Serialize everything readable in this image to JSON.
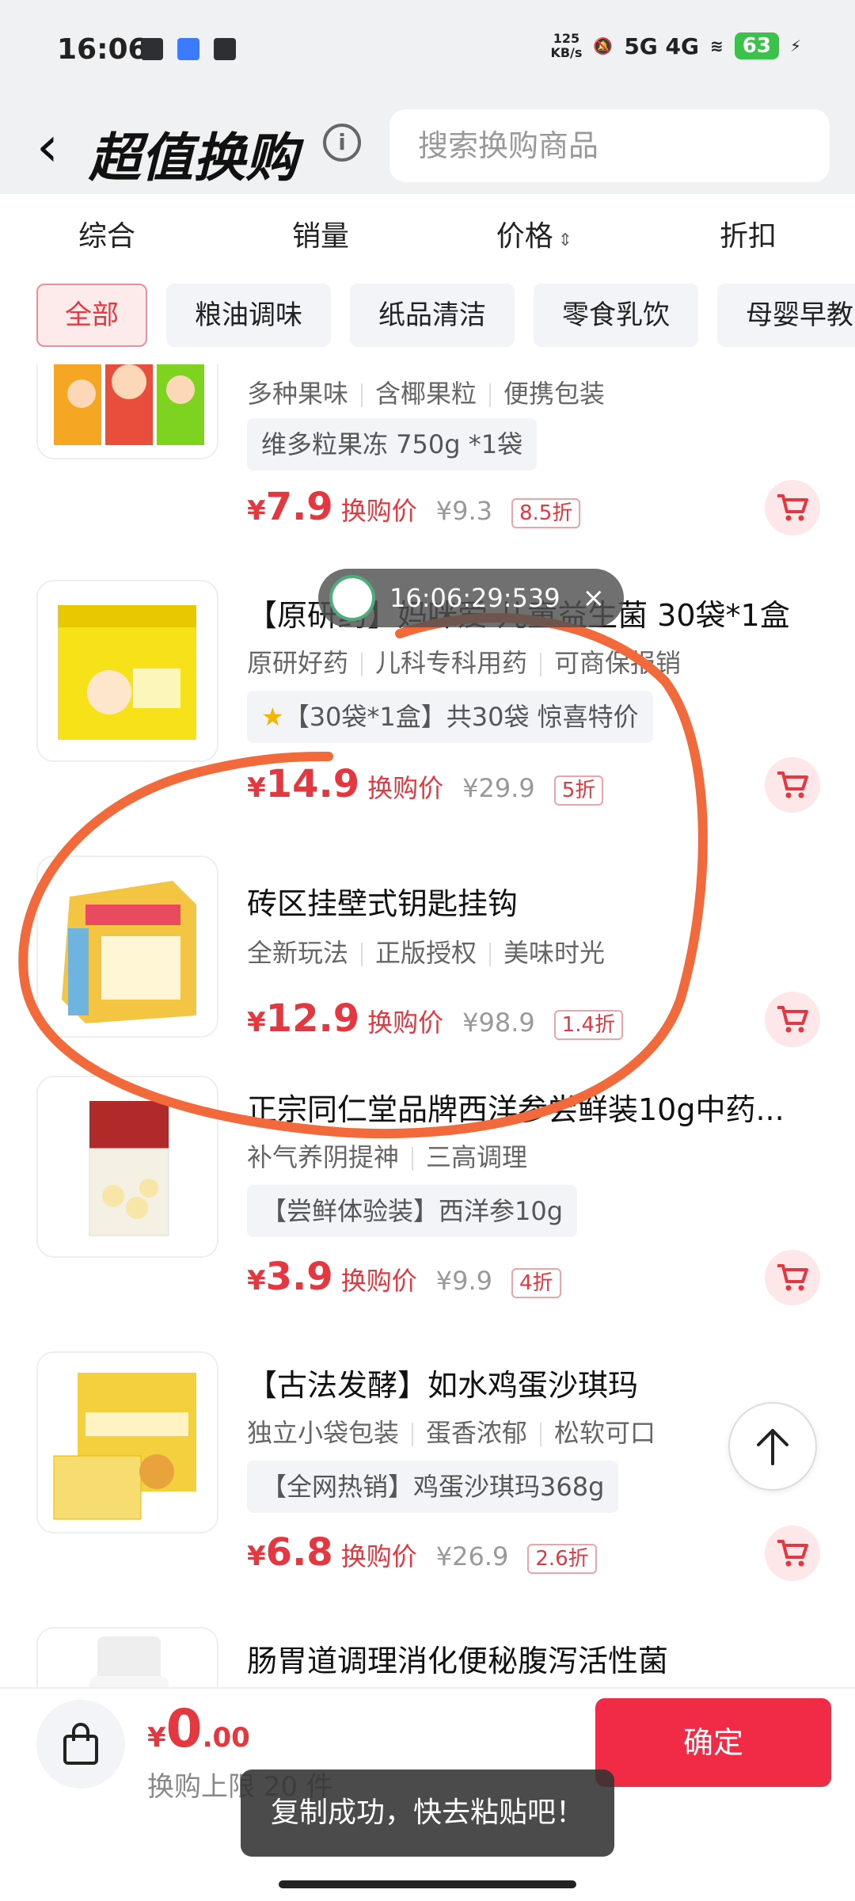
{
  "status_bar": {
    "time": "16:06",
    "speed": "125",
    "speed_unit": "KB/s",
    "network": "5G 4G",
    "battery": "63"
  },
  "header": {
    "back_icon": "chevron-left-icon",
    "title": "超值换购",
    "info_icon": "info-icon",
    "search_placeholder": "搜索换购商品"
  },
  "sort_tabs": [
    {
      "label": "综合"
    },
    {
      "label": "销量"
    },
    {
      "label": "价格"
    },
    {
      "label": "折扣"
    }
  ],
  "sort_sort_icon": "⌃⌄",
  "category_chips": [
    {
      "label": "全部",
      "active": true
    },
    {
      "label": "粮油调味"
    },
    {
      "label": "纸品清洁"
    },
    {
      "label": "零食乳饮"
    },
    {
      "label": "母婴早教"
    }
  ],
  "products": [
    {
      "name": "",
      "tags": [
        "多种果味",
        "含椰果粒",
        "便携包装"
      ],
      "spec": "维多粒果冻 750g *1袋",
      "price": "7.9",
      "price_label": "换购价",
      "orig_price": "¥9.3",
      "discount": "8.5折"
    },
    {
      "name": "【原研药】妈咪爱 儿童益生菌 30袋*1盒",
      "tags": [
        "原研好药",
        "儿科专科用药",
        "可商保报销"
      ],
      "spec": "【30袋*1盒】共30袋 惊喜特价",
      "price": "14.9",
      "price_label": "换购价",
      "orig_price": "¥29.9",
      "discount": "5折"
    },
    {
      "name": "砖区挂壁式钥匙挂钩",
      "tags": [
        "全新玩法",
        "正版授权",
        "美味时光"
      ],
      "spec": "",
      "price": "12.9",
      "price_label": "换购价",
      "orig_price": "¥98.9",
      "discount": "1.4折"
    },
    {
      "name": "正宗同仁堂品牌西洋参尝鲜装10g中药...",
      "tags": [
        "补气养阴提神",
        "三高调理"
      ],
      "spec": "【尝鲜体验装】西洋参10g",
      "price": "3.9",
      "price_label": "换购价",
      "orig_price": "¥9.9",
      "discount": "4折"
    },
    {
      "name": "【古法发酵】如水鸡蛋沙琪玛",
      "tags": [
        "独立小袋包装",
        "蛋香浓郁",
        "松软可口"
      ],
      "spec": "【全网热销】鸡蛋沙琪玛368g",
      "price": "6.8",
      "price_label": "换购价",
      "orig_price": "¥26.9",
      "discount": "2.6折"
    },
    {
      "name": "肠胃道调理消化便秘腹泻活性菌",
      "tags": [],
      "spec": "",
      "price": "",
      "price_label": "",
      "orig_price": "",
      "discount": ""
    }
  ],
  "timer_overlay": {
    "text": "16:06:29:539",
    "close": "×"
  },
  "bottom_bar": {
    "currency": "¥",
    "total_int": "0",
    "total_dec": ".00",
    "limit_text": "换购上限 20 件",
    "confirm_label": "确定"
  },
  "toast": "复制成功，快去粘贴吧！",
  "colors": {
    "accent_red": "#e4373f",
    "confirm_red": "#f12a45",
    "annotation_orange": "#f26a3c"
  }
}
